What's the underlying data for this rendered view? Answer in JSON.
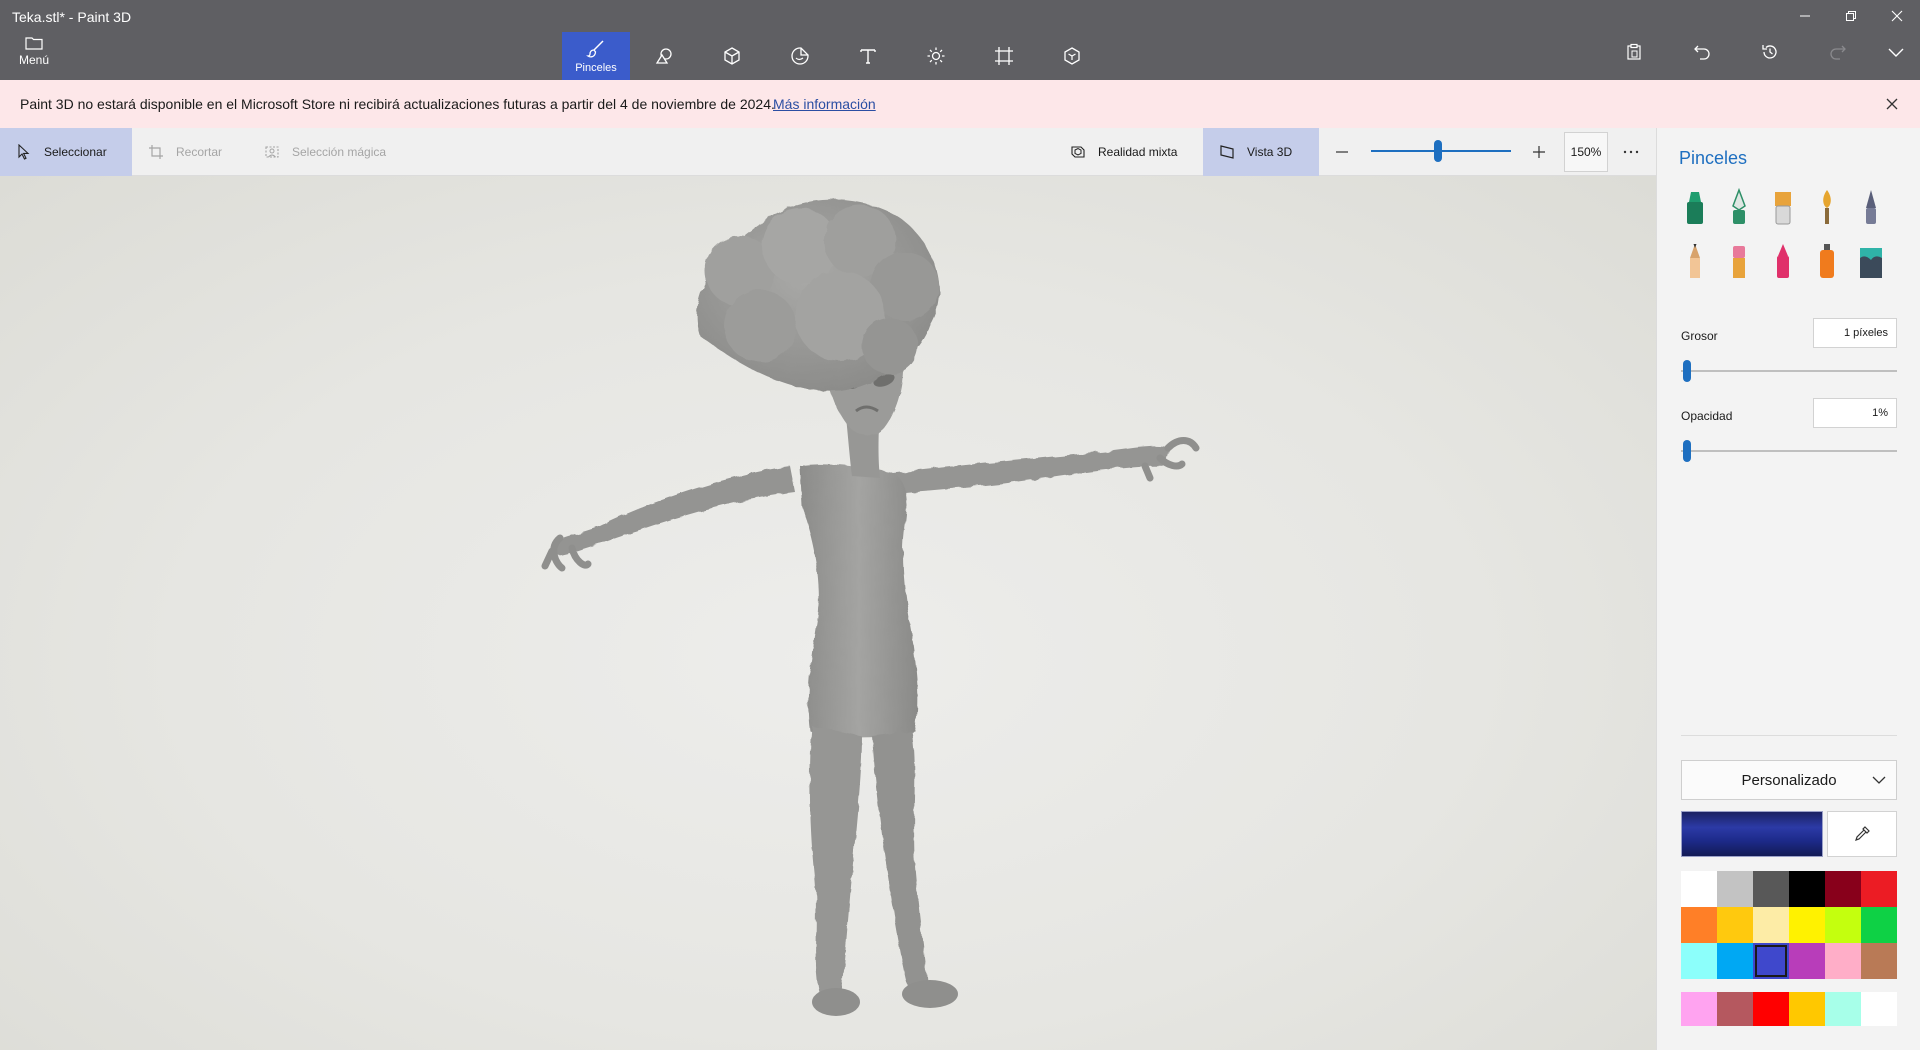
{
  "window": {
    "title": "Teka.stl* - Paint 3D",
    "controls": [
      "minimize-icon",
      "restore-icon",
      "close-icon"
    ]
  },
  "menu": {
    "label": "Menú",
    "icon": "folder-icon"
  },
  "toolbar": {
    "tools": [
      {
        "name": "brushes",
        "label": "Pinceles",
        "icon": "brush-icon",
        "active": true
      },
      {
        "name": "2d-shapes",
        "label": "",
        "icon": "shapes-2d-icon",
        "active": false
      },
      {
        "name": "3d-shapes",
        "label": "",
        "icon": "cube-icon",
        "active": false
      },
      {
        "name": "stickers",
        "label": "",
        "icon": "sticker-icon",
        "active": false
      },
      {
        "name": "text",
        "label": "",
        "icon": "text-icon",
        "active": false
      },
      {
        "name": "effects",
        "label": "",
        "icon": "sun-icon",
        "active": false
      },
      {
        "name": "canvas",
        "label": "",
        "icon": "canvas-icon",
        "active": false
      },
      {
        "name": "3d-library",
        "label": "",
        "icon": "3d-library-icon",
        "active": false
      }
    ],
    "right_actions": [
      "paste-icon",
      "undo-icon",
      "history-icon",
      "redo-icon",
      "expand-icon"
    ]
  },
  "notice": {
    "text": "Paint 3D no estará disponible en el Microsoft Store ni recibirá actualizaciones futuras a partir del 4 de noviembre de 2024.",
    "link": "Más información"
  },
  "commandbar": {
    "select": "Seleccionar",
    "crop": "Recortar",
    "magic_select": "Selección mágica",
    "mixed_reality": "Realidad mixta",
    "view_3d": "Vista 3D",
    "zoom_value": "150%",
    "zoom_level": 0.48
  },
  "panel": {
    "title": "Pinceles",
    "brushes": [
      {
        "name": "marker",
        "color": "#1f9e6f"
      },
      {
        "name": "calligraphy-pen",
        "color": "#2d8f67"
      },
      {
        "name": "oil-brush",
        "color": "#e8a33b"
      },
      {
        "name": "watercolor",
        "color": "#e6a52e"
      },
      {
        "name": "pixel-pen",
        "color": "#5a5f7a"
      },
      {
        "name": "pencil",
        "color": "#d8a36c"
      },
      {
        "name": "eraser",
        "color": "#e8799a"
      },
      {
        "name": "crayon",
        "color": "#e0306a"
      },
      {
        "name": "spray-can",
        "color": "#f07b1d"
      },
      {
        "name": "fill",
        "color": "#2fb3a8"
      }
    ],
    "thickness_label": "Grosor",
    "thickness_value": "1 píxeles",
    "thickness_level": 0.01,
    "opacity_label": "Opacidad",
    "opacity_value": "1%",
    "opacity_level": 0.01,
    "palette_name": "Personalizado",
    "current_color": "#2a3597",
    "swatches": [
      "#ffffff",
      "#c3c3c3",
      "#585858",
      "#000000",
      "#88001b",
      "#ec1c24",
      "#ff7f27",
      "#ffc90e",
      "#fdeca6",
      "#fff200",
      "#c4ff0e",
      "#0ed145",
      "#8cfffb",
      "#00a8f3",
      "#3f48cc",
      "#b83dba",
      "#ffaec8",
      "#b97a56"
    ],
    "selected_swatch_index": 14,
    "custom_swatches": [
      "#ffa3f0",
      "#b5585f",
      "#ff0000",
      "#ffc800",
      "#a7ffe9",
      "#ffffff"
    ]
  }
}
